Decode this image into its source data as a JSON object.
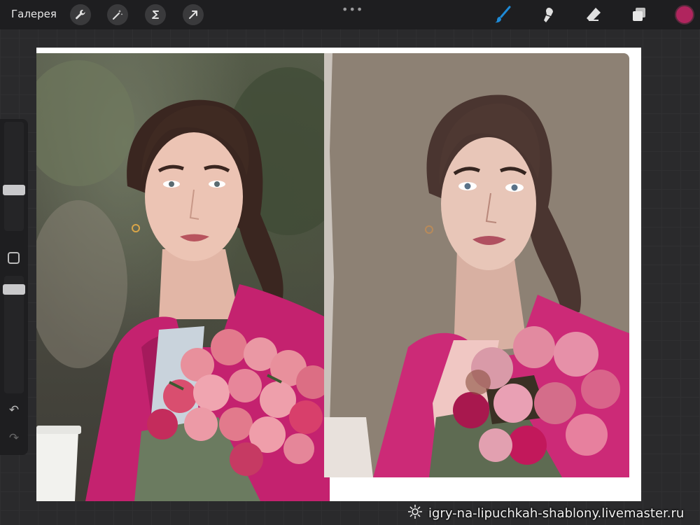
{
  "topbar": {
    "gallery_label": "Галерея",
    "left_tools": [
      "wrench-icon",
      "magic-wand-icon",
      "selection-s-icon",
      "transform-arrow-icon"
    ],
    "more_label": "•••",
    "right_tools": [
      "brush-icon",
      "smudge-icon",
      "eraser-icon",
      "layers-icon"
    ],
    "current_color": "#b0255e"
  },
  "sidebar": {
    "brush_size_level": 0.35,
    "opacity_level": 0.35,
    "undo_icon": "↶",
    "redo_icon": "↷"
  },
  "canvas": {
    "left_image": "reference photo: woman with dark ponytail in pink coat holding pink rose bouquet and coffee cup",
    "right_image": "digital painting in progress of the same woman on taupe background"
  },
  "watermark": {
    "text": "igry-na-lipuchkah-shablony.livemaster.ru"
  },
  "colors": {
    "accent": "#b0255e",
    "toolbar_bg": "#1e1e20",
    "brush_active": "#1e8ad6"
  }
}
